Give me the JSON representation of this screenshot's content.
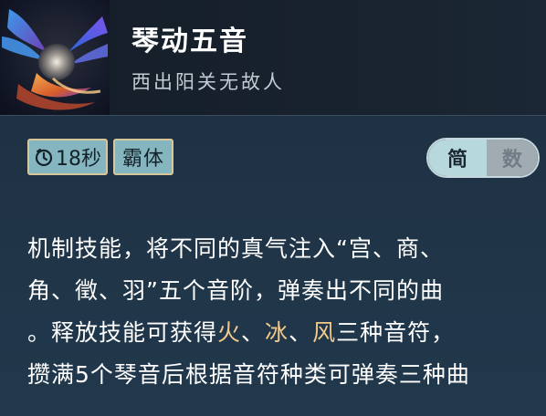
{
  "skill": {
    "name": "琴动五音",
    "subtitle": "西出阳关无故人",
    "icon": "qin-phoenix-skill-icon"
  },
  "badges": {
    "cooldown": "18秒",
    "cooldown_icon": "clock-icon",
    "armor": "霸体"
  },
  "toggle": {
    "simple_label": "简",
    "number_label": "数",
    "selected": "简"
  },
  "description": {
    "line1": "机制技能，将不同的真气注入“宫、商、",
    "line2": "角、徵、羽”五个音阶，弹奏出不同的曲",
    "line3_a": "。释放技能可获得",
    "kw_fire": "火",
    "sep1": "、",
    "kw_ice": "冰",
    "sep2": "、",
    "kw_wind": "风",
    "line3_b": "三种音符，",
    "line4": "攒满5个琴音后根据音符种类可弹奏三种曲"
  },
  "colors": {
    "keyword": "#f2c98a",
    "badge_bg": "#85b6bf",
    "badge_border": "#d8c79a",
    "toggle_active": "#b7d9de"
  }
}
